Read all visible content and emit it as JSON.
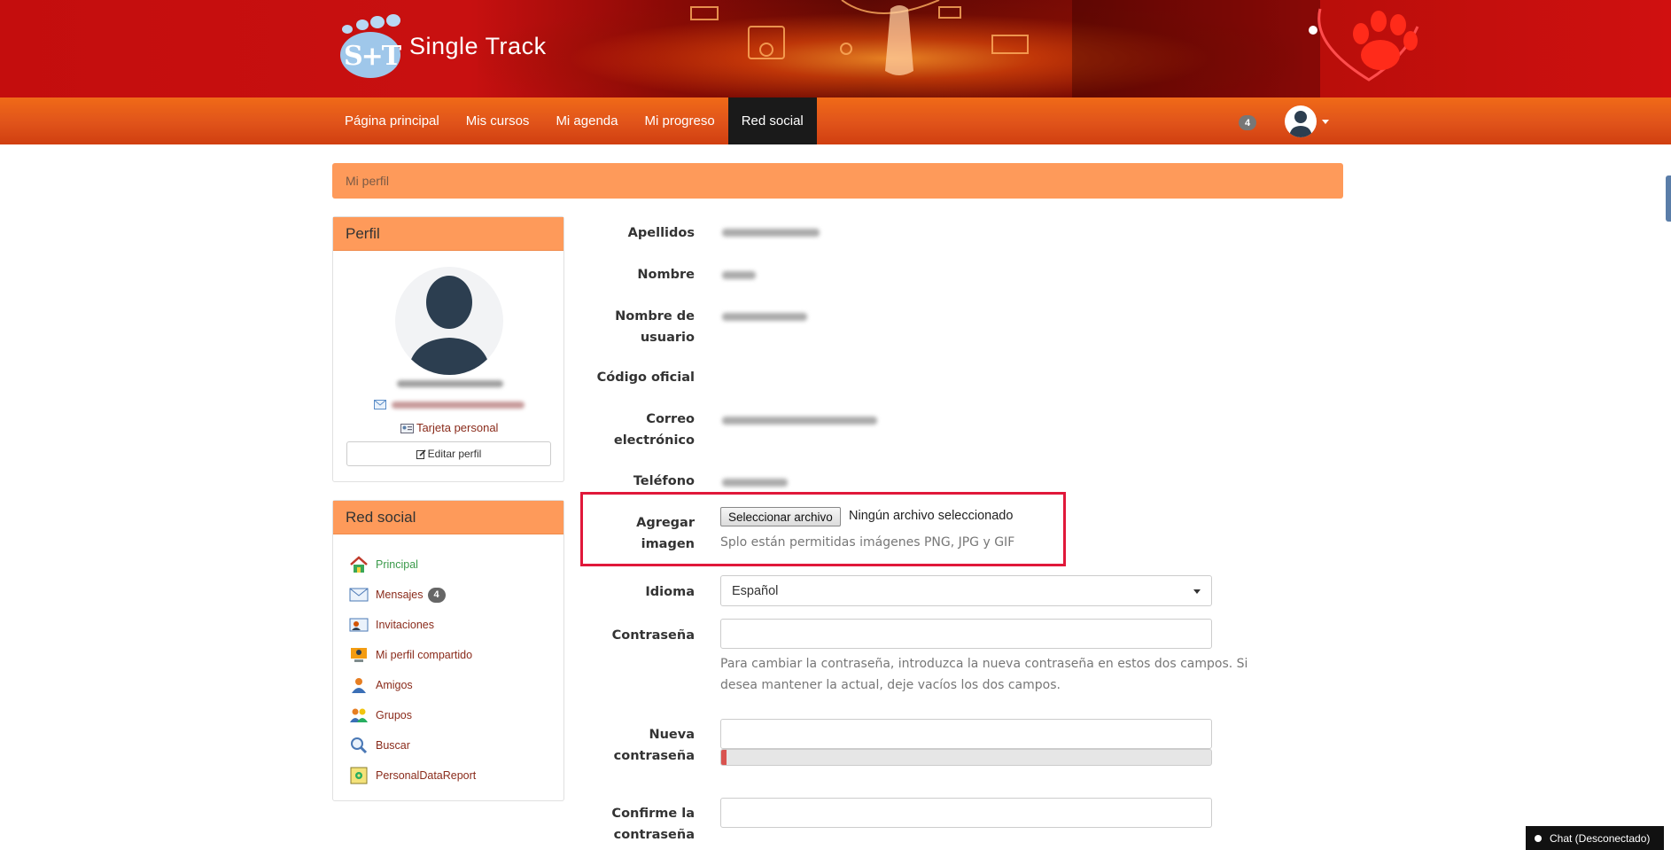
{
  "app": {
    "name": "Single Track",
    "logo_letters": "S+T"
  },
  "nav": {
    "items": [
      {
        "label": "Página principal"
      },
      {
        "label": "Mis cursos"
      },
      {
        "label": "Mi agenda"
      },
      {
        "label": "Mi progreso"
      },
      {
        "label": "Red social",
        "active": true
      }
    ],
    "notification_count": "4"
  },
  "breadcrumb": {
    "current": "Mi perfil"
  },
  "profile_panel": {
    "title": "Perfil",
    "card_link": "Tarjeta personal",
    "edit_button": "Editar perfil"
  },
  "social_panel": {
    "title": "Red social",
    "items": [
      {
        "label": "Principal",
        "icon": "home-icon",
        "active": true
      },
      {
        "label": "Mensajes",
        "icon": "envelope-icon",
        "badge": "4"
      },
      {
        "label": "Invitaciones",
        "icon": "invitation-icon"
      },
      {
        "label": "Mi perfil compartido",
        "icon": "shared-profile-icon"
      },
      {
        "label": "Amigos",
        "icon": "friend-icon"
      },
      {
        "label": "Grupos",
        "icon": "group-icon"
      },
      {
        "label": "Buscar",
        "icon": "search-icon"
      },
      {
        "label": "PersonalDataReport",
        "icon": "report-icon"
      }
    ]
  },
  "form": {
    "apellidos_label": "Apellidos",
    "nombre_label": "Nombre",
    "usuario_label_1": "Nombre de",
    "usuario_label_2": "usuario",
    "codigo_label": "Código oficial",
    "correo_label_1": "Correo",
    "correo_label_2": "electrónico",
    "telefono_label": "Teléfono",
    "imagen_label": "Agregar imagen",
    "file_button": "Seleccionar archivo",
    "file_status": "Ningún archivo seleccionado",
    "file_help": "Splo están permitidas imágenes PNG, JPG y GIF",
    "idioma_label": "Idioma",
    "idioma_value": "Español",
    "password_label": "Contraseña",
    "password_help_1": "Para cambiar la contraseña, introduzca la nueva contraseña en estos dos campos. Si",
    "password_help_2": "desea mantener la actual, deje vacíos los dos campos.",
    "new_password_label_1": "Nueva",
    "new_password_label_2": "contraseña",
    "password_strength": 0.01,
    "confirm_label_1": "Confirme la",
    "confirm_label_2": "contraseña"
  },
  "chat": {
    "label": "Chat (Desconectado)"
  },
  "colors": {
    "accent": "#fe9a5a",
    "nav": "#e0531a",
    "banner": "#c40d0d",
    "highlight": "#e0183a"
  }
}
